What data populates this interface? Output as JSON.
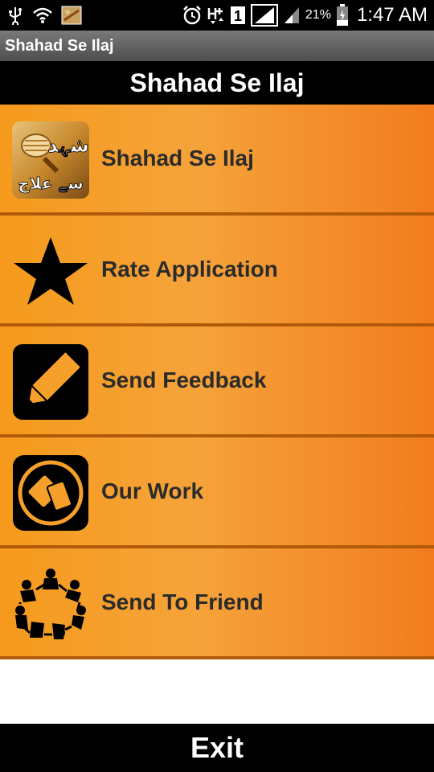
{
  "status_bar": {
    "battery": "21%",
    "time": "1:47 AM",
    "signal_label": "1"
  },
  "app_title": "Shahad Se Ilaj",
  "header": {
    "title": "Shahad Se Ilaj"
  },
  "menu": {
    "items": [
      {
        "label": "Shahad Se Ilaj",
        "icon": "honey-app-icon",
        "icon_text_1": "شہد",
        "icon_text_2": "سے علاج"
      },
      {
        "label": "Rate Application",
        "icon": "star-icon"
      },
      {
        "label": "Send Feedback",
        "icon": "pencil-icon"
      },
      {
        "label": "Our Work",
        "icon": "cards-icon"
      },
      {
        "label": "Send To Friend",
        "icon": "people-circle-icon"
      }
    ]
  },
  "exit_label": "Exit",
  "colors": {
    "menu_orange": "#f59a1c",
    "menu_divider": "#b15a0c",
    "header_black": "#000000",
    "label_text": "#2b2b2b"
  }
}
